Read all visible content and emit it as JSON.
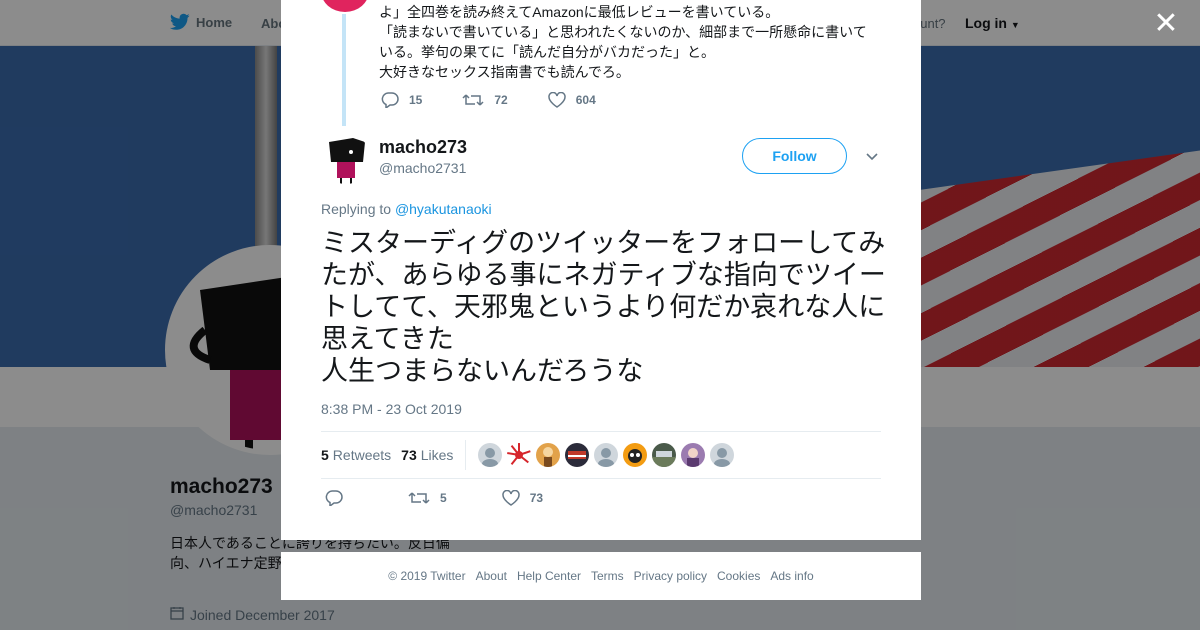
{
  "topbar": {
    "home_label": "Home",
    "about_label": "Abo",
    "account_label": "ccount?",
    "login_label": "Log in"
  },
  "profile": {
    "name": "macho273",
    "handle": "@macho2731",
    "bio": "日本人であることに誇りを持ちたい。反日偏向、ハイエナ定野党駆逐！ 日本",
    "joined": "Joined December 2017"
  },
  "previous_tweet": {
    "text": "よ」全四巻を読み終えてAmazonに最低レビューを書いている。\n「読まないで書いている」と思われたくないのか、細部まで一所懸命に書いている。挙句の果てに「読んだ自分がバカだった」と。\n大好きなセックス指南書でも読んでろ。",
    "replies": "15",
    "retweets": "72",
    "likes": "604"
  },
  "tweet": {
    "author_name": "macho273",
    "author_handle": "@macho2731",
    "follow_label": "Follow",
    "replying_prefix": "Replying to",
    "replying_to": "@hyakutanaoki",
    "text": "ミスターディグのツイッターをフォローしてみたが、あらゆる事にネガティブな指向でツイートしてて、天邪鬼というより何だか哀れな人に思えてきた\n人生つまらないんだろうな",
    "timestamp": "8:38 PM - 23 Oct 2019",
    "retweets_count": "5",
    "retweets_label": "Retweets",
    "likes_count": "73",
    "likes_label": "Likes",
    "action_retweets": "5",
    "action_likes": "73"
  },
  "footer": {
    "copyright": "© 2019 Twitter",
    "about": "About",
    "help": "Help Center",
    "terms": "Terms",
    "privacy": "Privacy policy",
    "cookies": "Cookies",
    "ads": "Ads info"
  },
  "colors": {
    "accent": "#1da1f2",
    "thread_line": "#c4e4f7",
    "prev_avatar": "#e0245e"
  },
  "icons": [
    "twitter-bird-icon",
    "reply-icon",
    "retweet-icon",
    "heart-icon",
    "chevron-down-icon",
    "close-icon",
    "calendar-icon"
  ]
}
